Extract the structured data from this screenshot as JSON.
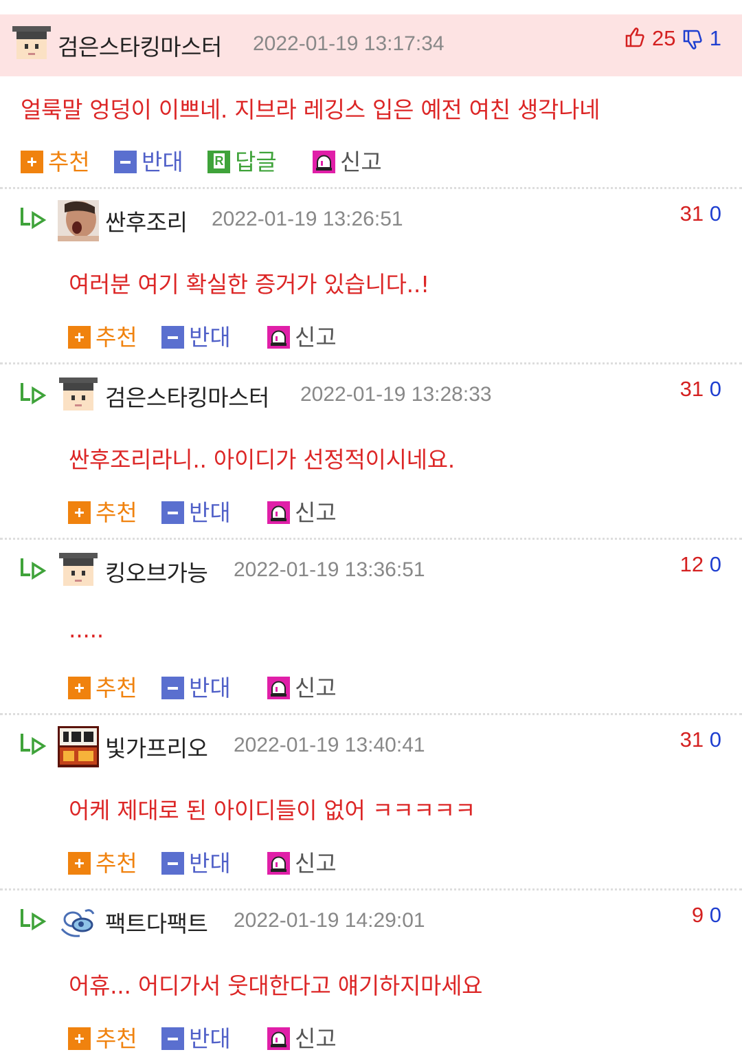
{
  "colors": {
    "header_bg": "#fde3e3",
    "comment_text": "#dc2626",
    "upvote": "#d42020",
    "downvote": "#1f3fd0",
    "recommend": "#f0820e",
    "oppose": "#5a6fcf",
    "reply": "#3fa33a",
    "report": "#e01fa8"
  },
  "actions": {
    "recommend": "추천",
    "oppose": "반대",
    "reply": "답글",
    "report": "신고"
  },
  "main_comment": {
    "author": "검은스타킹마스터",
    "avatar": "pixel-graduate-avatar",
    "date": "2022-01-19 13:17:34",
    "up": "25",
    "down": "1",
    "text": "얼룩말 엉덩이 이쁘네. 지브라 레깅스 입은 예전 여친 생각나네"
  },
  "replies": [
    {
      "author": "싼후조리",
      "avatar": "photo-avatar",
      "date": "2022-01-19 13:26:51",
      "up": "31",
      "down": "0",
      "text": "여러분 여기 확실한 증거가 있습니다..!"
    },
    {
      "author": "검은스타킹마스터",
      "avatar": "pixel-graduate-avatar",
      "date": "2022-01-19 13:28:33",
      "up": "31",
      "down": "0",
      "text": "싼후조리라니.. 아이디가 선정적이시네요."
    },
    {
      "author": "킹오브가능",
      "avatar": "pixel-graduate-avatar",
      "date": "2022-01-19 13:36:51",
      "up": "12",
      "down": "0",
      "text": "....."
    },
    {
      "author": "빛가프리오",
      "avatar": "badge-avatar",
      "date": "2022-01-19 13:40:41",
      "up": "31",
      "down": "0",
      "text": "어케 제대로 된 아이디들이 없어 ㅋㅋㅋㅋㅋ"
    },
    {
      "author": "팩트다팩트",
      "avatar": "doodle-avatar",
      "date": "2022-01-19 14:29:01",
      "up": "9",
      "down": "0",
      "text": "어휴... 어디가서 웃대한다고 얘기하지마세요"
    }
  ]
}
